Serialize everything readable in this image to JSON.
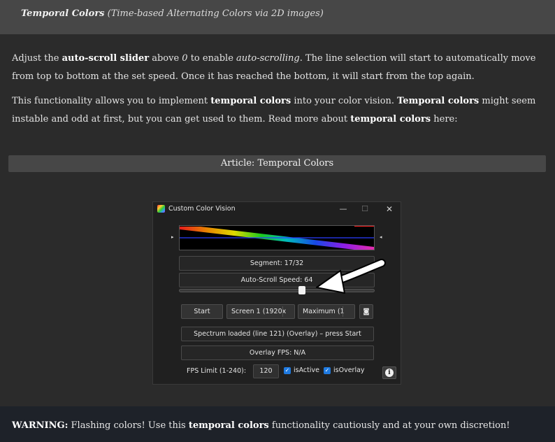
{
  "header": {
    "title": "Temporal Colors",
    "subtitle": "(Time-based Alternating Colors via 2D images)"
  },
  "intro": {
    "p1_a": "Adjust the ",
    "p1_b": "auto-scroll slider",
    "p1_c": " above ",
    "p1_d": "0",
    "p1_e": " to enable ",
    "p1_f": "auto-scrolling",
    "p1_g": ". The line selection will start to automatically move from top to bottom at the set speed. Once it has reached the bottom, it will start from the top again.",
    "p2_a": "This functionality allows you to implement ",
    "p2_b": "temporal colors",
    "p2_c": " into your color vision. ",
    "p2_d": "Temporal colors",
    "p2_e": " might seem instable and odd at first, but you can get used to them. Read more about ",
    "p2_f": "temporal colors",
    "p2_g": " here:"
  },
  "article_button": "Article: Temporal Colors",
  "window": {
    "title": "Custom Color Vision",
    "minimize": "—",
    "maximize": "☐",
    "close": "✕",
    "marker_left": "▸",
    "marker_right": "◂",
    "segment": "Segment: 17/32",
    "autoscroll": "Auto-Scroll Speed: 64",
    "slider_value": 0.63,
    "start": "Start",
    "screen": "Screen 1 (1920x",
    "maximum": "Maximum (1",
    "camera": "◙",
    "status": "Spectrum loaded (line 121) (Overlay) – press Start",
    "overlay_fps": "Overlay FPS: N/A",
    "fps_label": "FPS Limit (1-240):",
    "fps_value": "120",
    "check_mark": "✓",
    "is_active": "isActive",
    "is_overlay": "isOverlay",
    "info": "i"
  },
  "warning": {
    "a": "WARNING:",
    "b": " Flashing colors! Use this ",
    "c": "temporal colors",
    "d": " functionality cautiously and at your own discretion!"
  },
  "colors": {
    "accent": "#1f7ae0",
    "panel": "#474747",
    "background": "#2b2b2b",
    "warning_bg": "#1e2229"
  }
}
